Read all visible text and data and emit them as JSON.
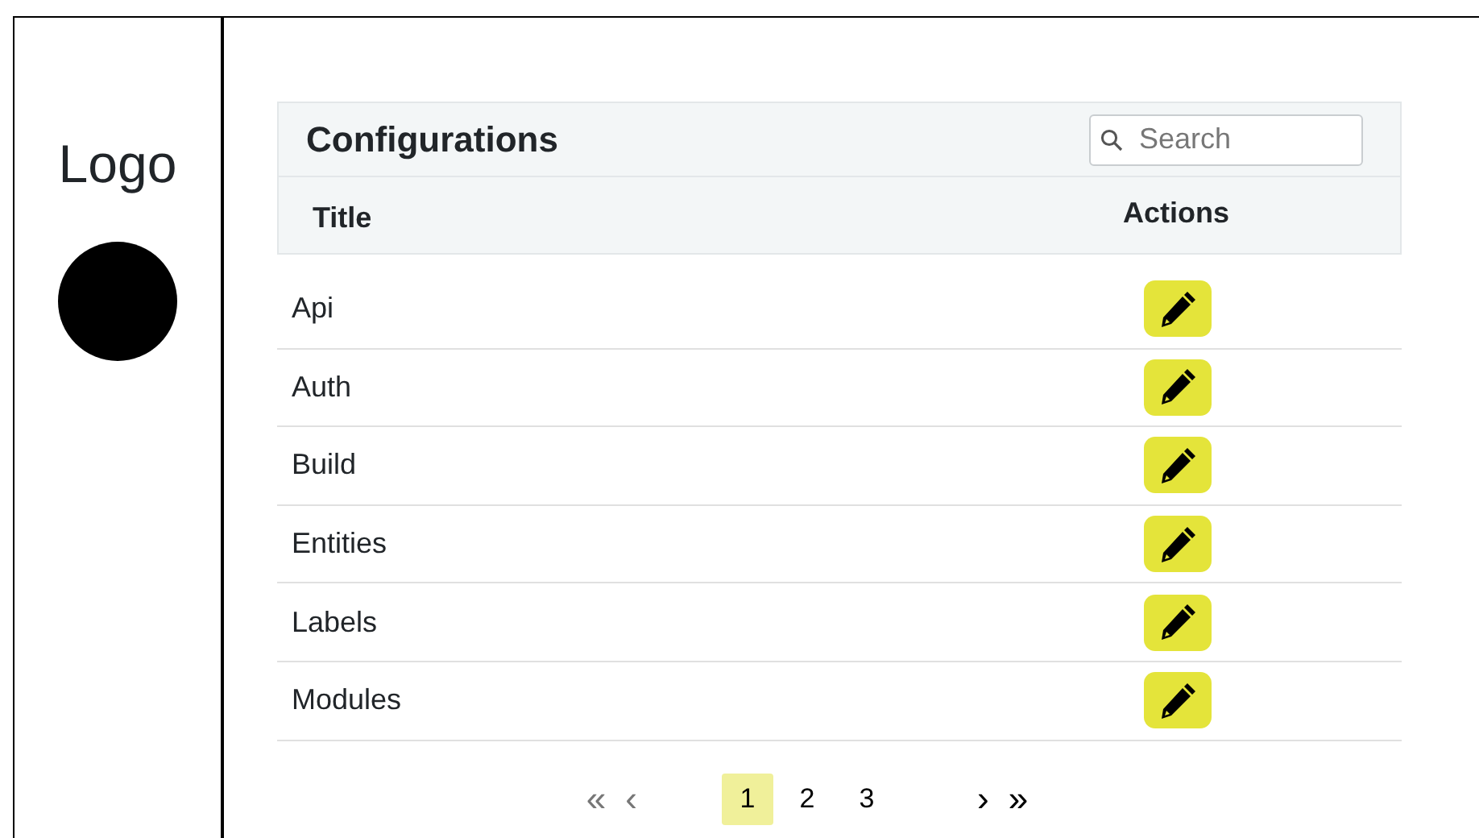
{
  "sidebar": {
    "logo": "Logo"
  },
  "table": {
    "title": "Configurations",
    "search": {
      "placeholder": "Search"
    },
    "columns": [
      "Title",
      "Actions"
    ],
    "rows": [
      {
        "title": "Api"
      },
      {
        "title": "Auth"
      },
      {
        "title": "Build"
      },
      {
        "title": "Entities"
      },
      {
        "title": "Labels"
      },
      {
        "title": "Modules"
      }
    ]
  },
  "pagination": {
    "first": {
      "label": "«",
      "disabled": true
    },
    "prev": {
      "label": "‹",
      "disabled": true
    },
    "pages": [
      {
        "label": "1",
        "selected": true
      },
      {
        "label": "2",
        "selected": false
      },
      {
        "label": "3",
        "selected": false
      }
    ],
    "next": {
      "label": "›",
      "disabled": false
    },
    "last": {
      "label": "»",
      "disabled": false
    }
  }
}
